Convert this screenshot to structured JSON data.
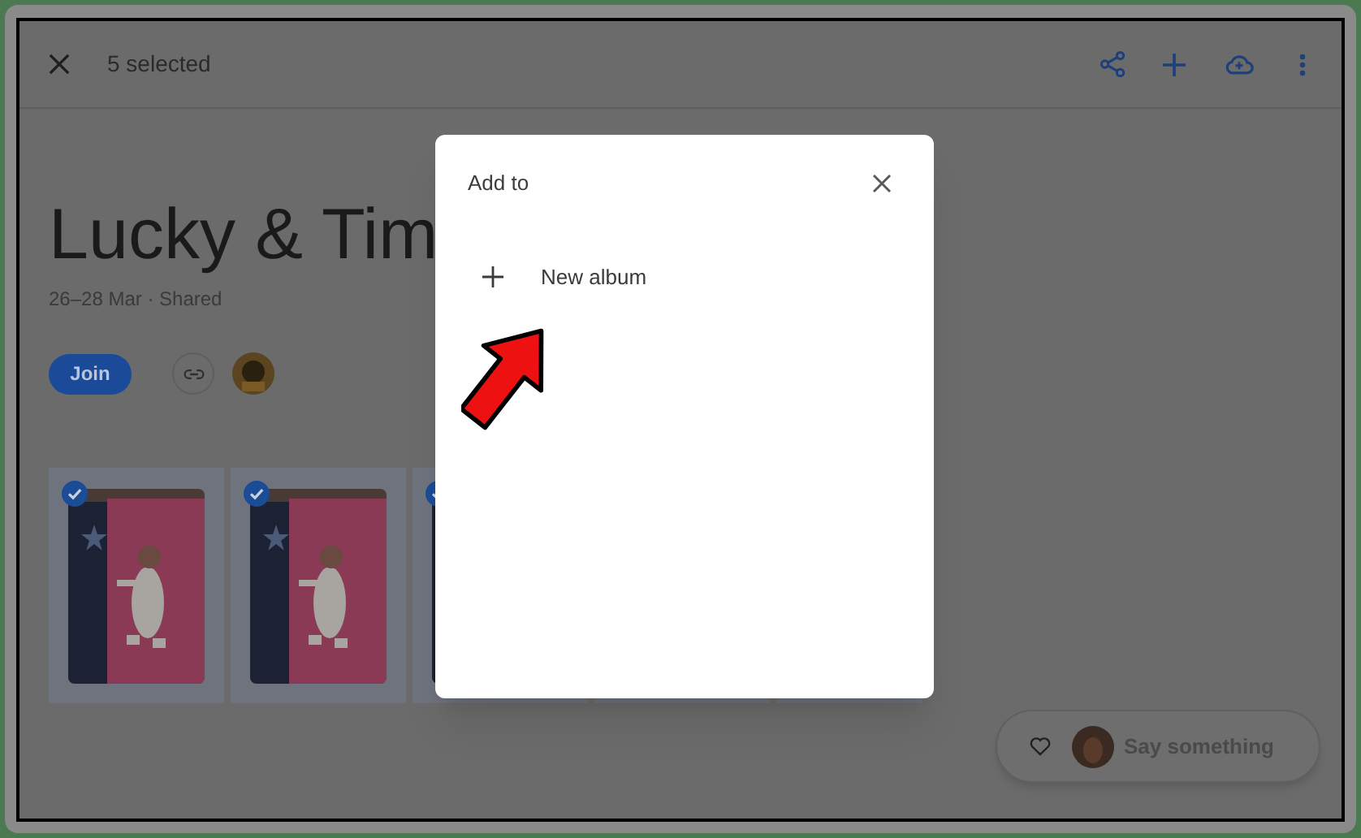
{
  "header": {
    "selected_count": "5 selected"
  },
  "album": {
    "title": "Lucky & Tim",
    "subtitle": "26–28 Mar · Shared",
    "join_button": "Join"
  },
  "photos": [
    {
      "selected": true
    },
    {
      "selected": true
    },
    {
      "selected": true
    }
  ],
  "comment_bar": {
    "placeholder": "Say something"
  },
  "dialog": {
    "title": "Add to",
    "items": [
      {
        "label": "New album"
      }
    ]
  }
}
